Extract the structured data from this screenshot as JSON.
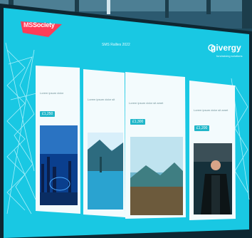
{
  "header": {
    "logo_left": {
      "ms": "MS",
      "rest": "Society"
    },
    "slide_title": "SMS Rallies 2022",
    "logo_right": {
      "name": "givergy",
      "tagline": "fundraising solutions"
    }
  },
  "cards": [
    {
      "label": "Lorem ipsum dolor",
      "price": "£1,250"
    },
    {
      "label": "Lorem ipsum dolor sit",
      "price": ""
    },
    {
      "label": "Lorem ipsum dolor sit amet",
      "price": "£1,300"
    },
    {
      "label": "Lorem ipsum dolor sit amet",
      "price": "£1,200"
    }
  ],
  "colors": {
    "screen": "#19c8e3",
    "card": "#f3fbfd",
    "accent": "#20b6c9",
    "ms_red": "#ff3d57"
  }
}
